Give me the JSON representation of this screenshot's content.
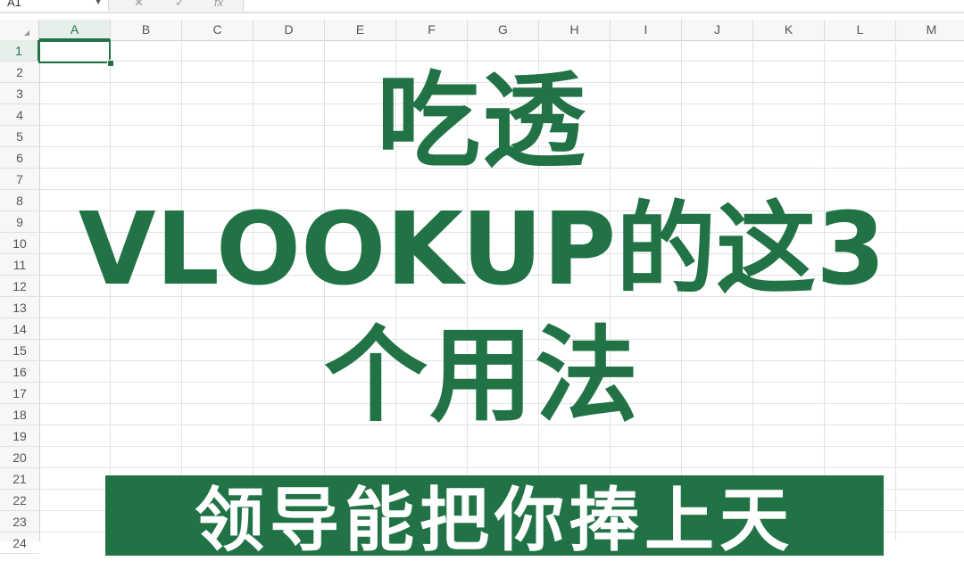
{
  "formula_bar": {
    "name_box": "A1",
    "cancel_icon": "✕",
    "confirm_icon": "✓",
    "function_icon": "fx"
  },
  "sheet": {
    "columns": [
      "A",
      "B",
      "C",
      "D",
      "E",
      "F",
      "G",
      "H",
      "I",
      "J",
      "K",
      "L",
      "M"
    ],
    "rows": [
      "1",
      "2",
      "3",
      "4",
      "5",
      "6",
      "7",
      "8",
      "9",
      "10",
      "11",
      "12",
      "13",
      "14",
      "15",
      "16",
      "17",
      "18",
      "19",
      "20",
      "21",
      "22",
      "23",
      "24"
    ],
    "active_column": "A",
    "active_row": "1"
  },
  "overlay": {
    "line1": "吃透",
    "line2": "VLOOKUP的这3",
    "line3": "个用法",
    "banner": "领导能把你捧上天"
  },
  "colors": {
    "accent": "#217346",
    "grid": "#e2e2e2",
    "header_bg": "#f7f7f7"
  }
}
